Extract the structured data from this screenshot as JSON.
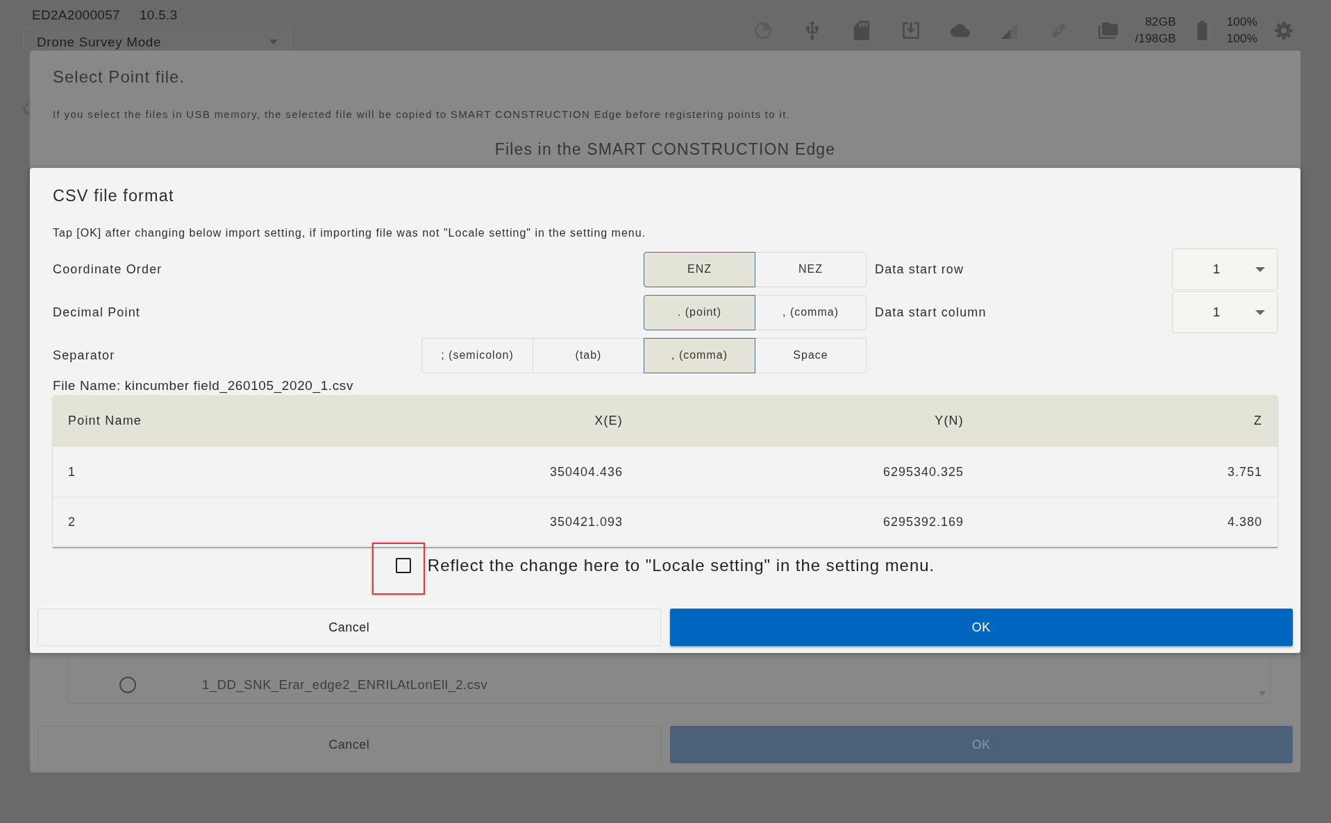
{
  "status_bar": {
    "device_id": "ED2A2000057",
    "version": "10.5.3",
    "mode": "Drone Survey Mode",
    "storage": [
      "82GB",
      "/198GB"
    ],
    "battery": [
      "100%",
      "100%"
    ]
  },
  "file_dialog": {
    "title": "Select Point file.",
    "message": "If you select the files in USB memory, the selected file will be copied to SMART CONSTRUCTION Edge before registering points to it.",
    "section_title": "Files in the SMART CONSTRUCTION Edge",
    "files": [
      {
        "name": "1_DD_SNK_Erar_edge2_ENRILAtLonEll_2.csv",
        "selected": false
      }
    ],
    "buttons": [
      {
        "label": "Cancel",
        "kind": "secondary",
        "disabled": false
      },
      {
        "label": "OK",
        "kind": "primary",
        "disabled": true
      }
    ]
  },
  "csv_dialog": {
    "title": "CSV file format",
    "message": "Tap [OK] after changing below import setting, if importing file was not \"Locale setting\" in the setting menu.",
    "settings": [
      {
        "label": "Coordinate Order",
        "options": [
          {
            "label": "ENZ",
            "selected": true
          },
          {
            "label": "NEZ",
            "selected": false
          }
        ]
      },
      {
        "label": "Decimal Point",
        "options": [
          {
            "label": ". (point)",
            "selected": true
          },
          {
            "label": ", (comma)",
            "selected": false
          }
        ]
      },
      {
        "label": "Separator",
        "options": [
          {
            "label": "; (semicolon)",
            "selected": false
          },
          {
            "label": "(tab)",
            "selected": false
          },
          {
            "label": ", (comma)",
            "selected": true
          },
          {
            "label": "Space",
            "selected": false
          }
        ]
      }
    ],
    "start_settings": [
      {
        "label": "Data start row",
        "value": "1"
      },
      {
        "label": "Data start column",
        "value": "1"
      }
    ],
    "file_name": "File Name: kincumber field_260105_2020_1.csv",
    "table": {
      "columns": [
        "Point Name",
        "X(E)",
        "Y(N)",
        "Z"
      ],
      "rows": [
        [
          "1",
          "350404.436",
          "6295340.325",
          "3.751"
        ],
        [
          "2",
          "350421.093",
          "6295392.169",
          "4.380"
        ]
      ]
    },
    "checkbox": {
      "label": "Reflect the change here to \"Locale setting\" in the setting menu.",
      "checked": false,
      "highlighted": true
    },
    "buttons": [
      {
        "label": "Cancel",
        "kind": "secondary",
        "disabled": false
      },
      {
        "label": "OK",
        "kind": "primary",
        "disabled": false
      }
    ]
  }
}
